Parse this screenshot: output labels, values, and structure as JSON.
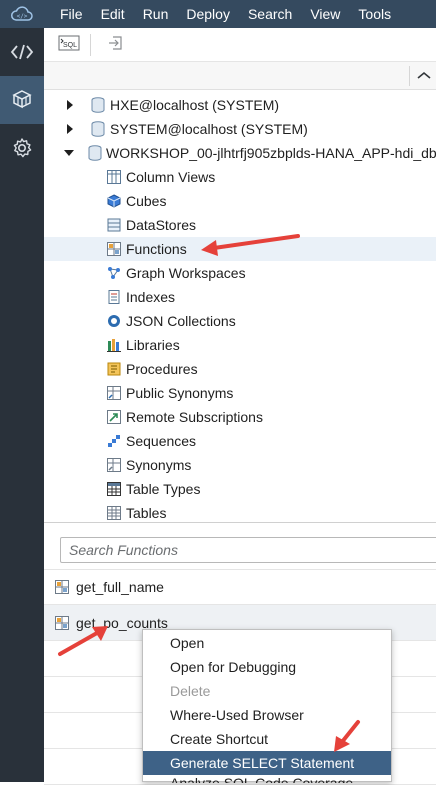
{
  "menubar": {
    "items": [
      "File",
      "Edit",
      "Run",
      "Deploy",
      "Search",
      "View",
      "Tools"
    ]
  },
  "activity_bar": {
    "items": [
      {
        "icon": "code-icon"
      },
      {
        "icon": "database-explorer-icon",
        "active": true
      },
      {
        "icon": "gear-icon"
      }
    ]
  },
  "toolbar": {
    "buttons": [
      {
        "icon": "sql-console-icon",
        "label": "SQL"
      },
      {
        "icon": "import-icon"
      }
    ]
  },
  "tree": {
    "connections": [
      {
        "label": "HXE@localhost (SYSTEM)",
        "expanded": false
      },
      {
        "label": "SYSTEM@localhost (SYSTEM)",
        "expanded": false
      },
      {
        "label": "WORKSHOP_00-jlhtrfj905zbplds-HANA_APP-hdi_db",
        "expanded": true
      }
    ],
    "nodes": [
      {
        "label": "Column Views",
        "icon": "column-views-icon"
      },
      {
        "label": "Cubes",
        "icon": "cubes-icon"
      },
      {
        "label": "DataStores",
        "icon": "datastores-icon"
      },
      {
        "label": "Functions",
        "icon": "functions-icon",
        "selected": true
      },
      {
        "label": "Graph Workspaces",
        "icon": "graph-workspaces-icon"
      },
      {
        "label": "Indexes",
        "icon": "indexes-icon"
      },
      {
        "label": "JSON Collections",
        "icon": "json-collections-icon"
      },
      {
        "label": "Libraries",
        "icon": "libraries-icon"
      },
      {
        "label": "Procedures",
        "icon": "procedures-icon"
      },
      {
        "label": "Public Synonyms",
        "icon": "public-synonyms-icon"
      },
      {
        "label": "Remote Subscriptions",
        "icon": "remote-subscriptions-icon"
      },
      {
        "label": "Sequences",
        "icon": "sequences-icon"
      },
      {
        "label": "Synonyms",
        "icon": "synonyms-icon"
      },
      {
        "label": "Table Types",
        "icon": "table-types-icon"
      },
      {
        "label": "Tables",
        "icon": "tables-icon"
      }
    ]
  },
  "search": {
    "placeholder": "Search Functions",
    "results": [
      {
        "label": "get_full_name"
      },
      {
        "label": "get_po_counts",
        "highlighted": true
      }
    ]
  },
  "context_menu": {
    "items": [
      {
        "label": "Open"
      },
      {
        "label": "Open for Debugging"
      },
      {
        "label": "Delete",
        "disabled": true
      },
      {
        "label": "Where-Used Browser"
      },
      {
        "label": "Create Shortcut"
      },
      {
        "label": "Generate SELECT Statement",
        "active": true
      },
      {
        "label": "Analyze SQL Code Coverage"
      }
    ]
  },
  "colors": {
    "menubar_bg": "#354a5f",
    "activity_bg": "#29313a",
    "active_menu_item": "#3e6287",
    "arrow_red": "#e5413a"
  }
}
